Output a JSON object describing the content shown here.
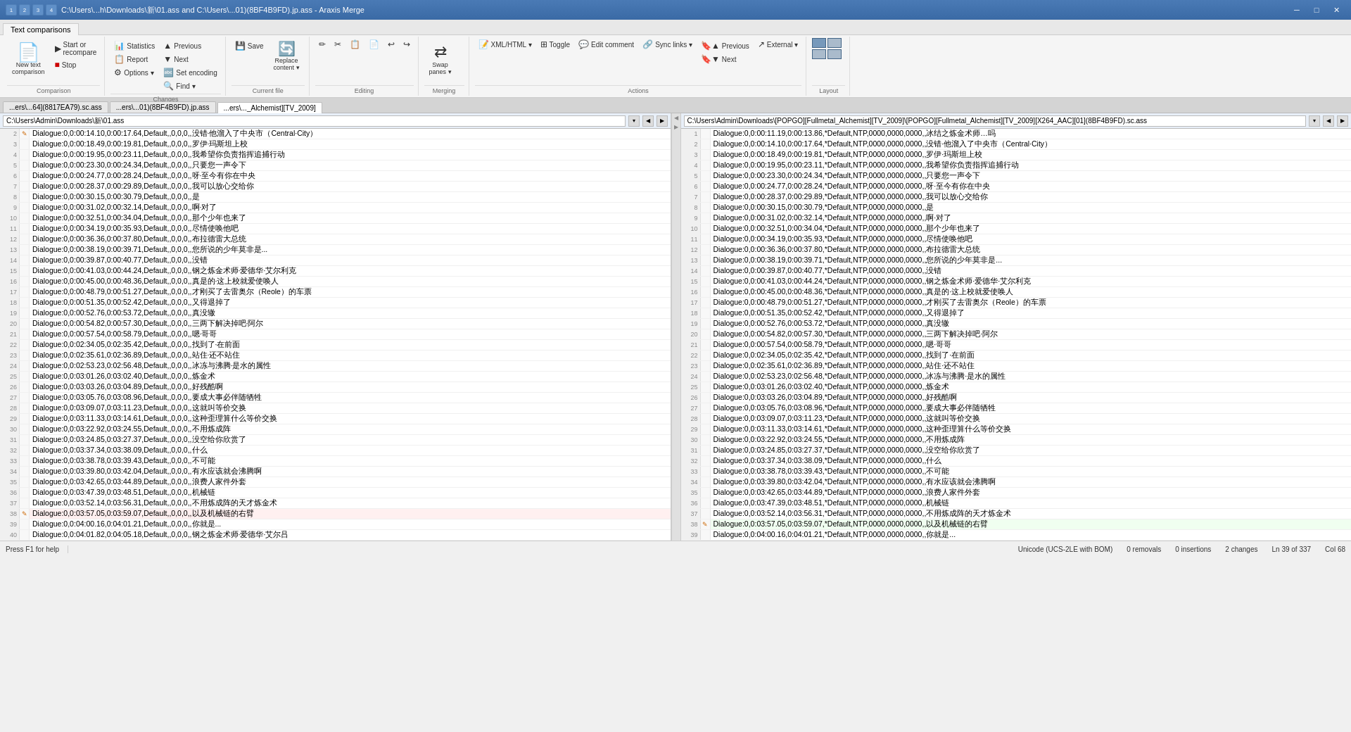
{
  "titleBar": {
    "title": "C:\\Users\\...h\\Downloads\\新\\01.ass and C:\\Users\\...01)(8BF4B9FD).jp.ass - Araxis Merge",
    "icons": [
      "1",
      "2",
      "3",
      "4"
    ],
    "appName": "Araxis Merge"
  },
  "ribbonTabs": [
    {
      "label": "Text comparisons",
      "active": true
    }
  ],
  "groups": {
    "comparison": {
      "label": "Comparison",
      "newText": "New text\ncomparison",
      "startRecompare": "Start or\nrecompare",
      "stop": "Stop"
    },
    "changes": {
      "label": "Changes",
      "statistics": "Statistics",
      "report": "Report",
      "previous": "Previous",
      "next": "Next",
      "setEncoding": "Set encoding",
      "find": "Find ▾",
      "options": "Options ▾"
    },
    "currentFile": {
      "label": "Current file",
      "save": "Save",
      "replaceContent": "Replace\ncontent ▾"
    },
    "editing": {
      "label": "Editing"
    },
    "merging": {
      "label": "Merging",
      "swapPanes": "Swap\npanes ▾"
    },
    "actions": {
      "label": "Actions",
      "xmlHtml": "XML/HTML ▾",
      "syncLinks": "Sync links ▾",
      "external": "External ▾",
      "toggle": "Toggle",
      "editComment": "Edit comment",
      "previousBookmark": "Previous",
      "nextBookmark": "Next"
    },
    "layout": {
      "label": "Layout"
    }
  },
  "fileTabs": [
    {
      "label": "...ers\\...64](8817EA79).sc.ass",
      "active": false
    },
    {
      "label": "...ers\\...01)(8BF4B9FD).jp.ass",
      "active": false
    },
    {
      "label": "...ers\\..._Alchemist][TV_2009]",
      "active": true
    }
  ],
  "leftPanel": {
    "path": "C:\\Users\\Admin\\Downloads\\新\\01.ass",
    "lines": [
      {
        "num": 2,
        "marker": "✎",
        "changed": false,
        "text": "Dialogue:0,0:00:14.10,0:00:17.64,Default,,0,0,0,,没错·他溜入了中央市（Central·City）"
      },
      {
        "num": 3,
        "marker": "",
        "changed": false,
        "text": "Dialogue:0,0:00:18.49,0:00:19.81,Default,,0,0,0,,罗伊·玛斯坦上校"
      },
      {
        "num": 4,
        "marker": "",
        "changed": false,
        "text": "Dialogue:0,0:00:19.95,0:00:23.11,Default,,0,0,0,,我希望你负责指挥追捕行动"
      },
      {
        "num": 5,
        "marker": "",
        "changed": false,
        "text": "Dialogue:0,0:00:23.30,0:00:24.34,Default,,0,0,0,,只要您一声令下"
      },
      {
        "num": 6,
        "marker": "",
        "changed": false,
        "text": "Dialogue:0,0:00:24.77,0:00:28.24,Default,,0,0,0,,呀·至今有你在中央"
      },
      {
        "num": 7,
        "marker": "",
        "changed": false,
        "text": "Dialogue:0,0:00:28.37,0:00:29.89,Default,,0,0,0,,我可以放心交给你"
      },
      {
        "num": 8,
        "marker": "",
        "changed": false,
        "text": "Dialogue:0,0:00:30.15,0:00:30.79,Default,,0,0,0,,是"
      },
      {
        "num": 9,
        "marker": "",
        "changed": false,
        "text": "Dialogue:0,0:00:31.02,0:00:32.14,Default,,0,0,0,,啊·对了"
      },
      {
        "num": 10,
        "marker": "",
        "changed": false,
        "text": "Dialogue:0,0:00:32.51,0:00:34.04,Default,,0,0,0,,那个少年也来了"
      },
      {
        "num": 11,
        "marker": "",
        "changed": false,
        "text": "Dialogue:0,0:00:34.19,0:00:35.93,Default,,0,0,0,,尽情使唤他吧"
      },
      {
        "num": 12,
        "marker": "",
        "changed": false,
        "text": "Dialogue:0,0:00:36.36,0:00:37.80,Default,,0,0,0,,布拉德雷大总统"
      },
      {
        "num": 13,
        "marker": "",
        "changed": false,
        "text": "Dialogue:0,0:00:38.19,0:00:39.71,Default,,0,0,0,,您所说的少年莫非是..."
      },
      {
        "num": 14,
        "marker": "",
        "changed": false,
        "text": "Dialogue:0,0:00:39.87,0:00:40.77,Default,,0,0,0,,没错"
      },
      {
        "num": 15,
        "marker": "",
        "changed": false,
        "text": "Dialogue:0,0:00:41.03,0:00:44.24,Default,,0,0,0,,钢之炼金术师·爱德华·艾尔利克"
      },
      {
        "num": 16,
        "marker": "",
        "changed": false,
        "text": "Dialogue:0,0:00:45.00,0:00:48.36,Default,,0,0,0,,真是的·这上校就爱使唤人"
      },
      {
        "num": 17,
        "marker": "",
        "changed": false,
        "text": "Dialogue:0,0:00:48.79,0:00:51.27,Default,,0,0,0,,才刚买了去雷奥尔（Reole）的车票"
      },
      {
        "num": 18,
        "marker": "",
        "changed": false,
        "text": "Dialogue:0,0:00:51.35,0:00:52.42,Default,,0,0,0,,又得退掉了"
      },
      {
        "num": 19,
        "marker": "",
        "changed": false,
        "text": "Dialogue:0,0:00:52.76,0:00:53.72,Default,,0,0,0,,真没辙"
      },
      {
        "num": 20,
        "marker": "",
        "changed": false,
        "text": "Dialogue:0,0:00:54.82,0:00:57.30,Default,,0,0,0,,三两下解决掉吧·阿尔"
      },
      {
        "num": 21,
        "marker": "",
        "changed": false,
        "text": "Dialogue:0,0:00:57.54,0:00:58.79,Default,,0,0,0,,嗯·哥哥"
      },
      {
        "num": 22,
        "marker": "",
        "changed": false,
        "text": "Dialogue:0,0:02:34.05,0:02:35.42,Default,,0,0,0,,找到了·在前面"
      },
      {
        "num": 23,
        "marker": "",
        "changed": false,
        "text": "Dialogue:0,0:02:35.61,0:02:36.89,Default,,0,0,0,,站住·还不站住"
      },
      {
        "num": 24,
        "marker": "",
        "changed": false,
        "text": "Dialogue:0,0:02:53.23,0:02:56.48,Default,,0,0,0,,冰冻与沸腾·是水的属性"
      },
      {
        "num": 25,
        "marker": "",
        "changed": false,
        "text": "Dialogue:0,0:03:01.26,0:03:02.40,Default,,0,0,0,,炼金术"
      },
      {
        "num": 26,
        "marker": "",
        "changed": false,
        "text": "Dialogue:0,0:03:03.26,0:03:04.89,Default,,0,0,0,,好残酷啊"
      },
      {
        "num": 27,
        "marker": "",
        "changed": false,
        "text": "Dialogue:0,0:03:05.76,0:03:08.96,Default,,0,0,0,,要成大事必伴随牺牲"
      },
      {
        "num": 28,
        "marker": "",
        "changed": false,
        "text": "Dialogue:0,0:03:09.07,0:03:11.23,Default,,0,0,0,,这就叫等价交换"
      },
      {
        "num": 29,
        "marker": "",
        "changed": false,
        "text": "Dialogue:0,0:03:11.33,0:03:14.61,Default,,0,0,0,,这种歪理算什么等价交换"
      },
      {
        "num": 30,
        "marker": "",
        "changed": false,
        "text": "Dialogue:0,0:03:22.92,0:03:24.55,Default,,0,0,0,,不用炼成阵"
      },
      {
        "num": 31,
        "marker": "",
        "changed": false,
        "text": "Dialogue:0,0:03:24.85,0:03:27.37,Default,,0,0,0,,没空给你欣赏了"
      },
      {
        "num": 32,
        "marker": "",
        "changed": false,
        "text": "Dialogue:0,0:03:37.34,0:03:38.09,Default,,0,0,0,,什么"
      },
      {
        "num": 33,
        "marker": "",
        "changed": false,
        "text": "Dialogue:0,0:03:38.78,0:03:39.43,Default,,0,0,0,,不可能"
      },
      {
        "num": 34,
        "marker": "",
        "changed": false,
        "text": "Dialogue:0,0:03:39.80,0:03:42.04,Default,,0,0,0,,有水应该就会沸腾啊"
      },
      {
        "num": 35,
        "marker": "",
        "changed": false,
        "text": "Dialogue:0,0:03:42.65,0:03:44.89,Default,,0,0,0,,浪费人家件外套"
      },
      {
        "num": 36,
        "marker": "",
        "changed": false,
        "text": "Dialogue:0,0:03:47.39,0:03:48.51,Default,,0,0,0,,机械链"
      },
      {
        "num": 37,
        "marker": "",
        "changed": false,
        "text": "Dialogue:0,0:03:52.14,0:03:56.31,Default,,0,0,0,,不用炼成阵的天才炼金术"
      },
      {
        "num": 38,
        "marker": "✎",
        "changed": true,
        "text": "Dialogue:0,0:03:57.05,0:03:59.07,Default,,0,0,0,,以及机械链的右臂"
      },
      {
        "num": 39,
        "marker": "",
        "changed": false,
        "text": "Dialogue:0,0:04:00.16,0:04:01.21,Default,,0,0,0,,你就是..."
      },
      {
        "num": 40,
        "marker": "",
        "changed": false,
        "text": "Dialogue:0,0:04:01.82,0:04:05.18,Default,,0,0,0,,钢之炼金术师·爱德华·艾尔吕"
      }
    ]
  },
  "rightPanel": {
    "path": "C:\\Users\\Admin\\Downloads\\[POPGO][Fullmetal_Alchemist][TV_2009]\\[POPGO][Fullmetal_Alchemist][TV_2009][X264_AAC][01](8BF4B9FD).sc.ass",
    "lines": [
      {
        "num": 1,
        "marker": "",
        "changed": false,
        "text": "Dialogue:0,0:00:11.19,0:00:13.86,*Default,NTP,0000,0000,0000,,冰结之炼金术师…吗"
      },
      {
        "num": 2,
        "marker": "",
        "changed": false,
        "text": "Dialogue:0,0:00:14.10,0:00:17.64,*Default,NTP,0000,0000,0000,,没错·他溜入了中央市（Central·City）"
      },
      {
        "num": 3,
        "marker": "",
        "changed": false,
        "text": "Dialogue:0,0:00:18.49,0:00:19.81,*Default,NTP,0000,0000,0000,,罗伊·玛斯坦上校"
      },
      {
        "num": 4,
        "marker": "",
        "changed": false,
        "text": "Dialogue:0,0:00:19.95,0:00:23.11,*Default,NTP,0000,0000,0000,,我希望你负责指挥追捕行动"
      },
      {
        "num": 5,
        "marker": "",
        "changed": false,
        "text": "Dialogue:0,0:00:23.30,0:00:24.34,*Default,NTP,0000,0000,0000,,只要您一声令下"
      },
      {
        "num": 6,
        "marker": "",
        "changed": false,
        "text": "Dialogue:0,0:00:24.77,0:00:28.24,*Default,NTP,0000,0000,0000,,呀·至今有你在中央"
      },
      {
        "num": 7,
        "marker": "",
        "changed": false,
        "text": "Dialogue:0,0:00:28.37,0:00:29.89,*Default,NTP,0000,0000,0000,,我可以放心交给你"
      },
      {
        "num": 8,
        "marker": "",
        "changed": false,
        "text": "Dialogue:0,0:00:30.15,0:00:30.79,*Default,NTP,0000,0000,0000,,是"
      },
      {
        "num": 9,
        "marker": "",
        "changed": false,
        "text": "Dialogue:0,0:00:31.02,0:00:32.14,*Default,NTP,0000,0000,0000,,啊·对了"
      },
      {
        "num": 10,
        "marker": "",
        "changed": false,
        "text": "Dialogue:0,0:00:32.51,0:00:34.04,*Default,NTP,0000,0000,0000,,那个少年也来了"
      },
      {
        "num": 11,
        "marker": "",
        "changed": false,
        "text": "Dialogue:0,0:00:34.19,0:00:35.93,*Default,NTP,0000,0000,0000,,尽情使唤他吧"
      },
      {
        "num": 12,
        "marker": "",
        "changed": false,
        "text": "Dialogue:0,0:00:36.36,0:00:37.80,*Default,NTP,0000,0000,0000,,布拉德雷大总统"
      },
      {
        "num": 13,
        "marker": "",
        "changed": false,
        "text": "Dialogue:0,0:00:38.19,0:00:39.71,*Default,NTP,0000,0000,0000,,您所说的少年莫非是..."
      },
      {
        "num": 14,
        "marker": "",
        "changed": false,
        "text": "Dialogue:0,0:00:39.87,0:00:40.77,*Default,NTP,0000,0000,0000,,没错"
      },
      {
        "num": 15,
        "marker": "",
        "changed": false,
        "text": "Dialogue:0,0:00:41.03,0:00:44.24,*Default,NTP,0000,0000,0000,,钢之炼金术师·爱德华·艾尔利克"
      },
      {
        "num": 16,
        "marker": "",
        "changed": false,
        "text": "Dialogue:0,0:00:45.00,0:00:48.36,*Default,NTP,0000,0000,0000,,真是的·这上校就爱使唤人"
      },
      {
        "num": 17,
        "marker": "",
        "changed": false,
        "text": "Dialogue:0,0:00:48.79,0:00:51.27,*Default,NTP,0000,0000,0000,,才刚买了去雷奥尔（Reole）的车票"
      },
      {
        "num": 18,
        "marker": "",
        "changed": false,
        "text": "Dialogue:0,0:00:51.35,0:00:52.42,*Default,NTP,0000,0000,0000,,又得退掉了"
      },
      {
        "num": 19,
        "marker": "",
        "changed": false,
        "text": "Dialogue:0,0:00:52.76,0:00:53.72,*Default,NTP,0000,0000,0000,,真没辙"
      },
      {
        "num": 20,
        "marker": "",
        "changed": false,
        "text": "Dialogue:0,0:00:54.82,0:00:57.30,*Default,NTP,0000,0000,0000,,三两下解决掉吧·阿尔"
      },
      {
        "num": 21,
        "marker": "",
        "changed": false,
        "text": "Dialogue:0,0:00:57.54,0:00:58.79,*Default,NTP,0000,0000,0000,,嗯·哥哥"
      },
      {
        "num": 22,
        "marker": "",
        "changed": false,
        "text": "Dialogue:0,0:02:34.05,0:02:35.42,*Default,NTP,0000,0000,0000,,找到了·在前面"
      },
      {
        "num": 23,
        "marker": "",
        "changed": false,
        "text": "Dialogue:0,0:02:35.61,0:02:36.89,*Default,NTP,0000,0000,0000,,站住·还不站住"
      },
      {
        "num": 24,
        "marker": "",
        "changed": false,
        "text": "Dialogue:0,0:02:53.23,0:02:56.48,*Default,NTP,0000,0000,0000,,冰冻与沸腾·是水的属性"
      },
      {
        "num": 25,
        "marker": "",
        "changed": false,
        "text": "Dialogue:0,0:03:01.26,0:03:02.40,*Default,NTP,0000,0000,0000,,炼金术"
      },
      {
        "num": 26,
        "marker": "",
        "changed": false,
        "text": "Dialogue:0,0:03:03.26,0:03:04.89,*Default,NTP,0000,0000,0000,,好残酷啊"
      },
      {
        "num": 27,
        "marker": "",
        "changed": false,
        "text": "Dialogue:0,0:03:05.76,0:03:08.96,*Default,NTP,0000,0000,0000,,要成大事必伴随牺牲"
      },
      {
        "num": 28,
        "marker": "",
        "changed": false,
        "text": "Dialogue:0,0:03:09.07,0:03:11.23,*Default,NTP,0000,0000,0000,,这就叫等价交换"
      },
      {
        "num": 29,
        "marker": "",
        "changed": false,
        "text": "Dialogue:0,0:03:11.33,0:03:14.61,*Default,NTP,0000,0000,0000,,这种歪理算什么等价交换"
      },
      {
        "num": 30,
        "marker": "",
        "changed": false,
        "text": "Dialogue:0,0:03:22.92,0:03:24.55,*Default,NTP,0000,0000,0000,,不用炼成阵"
      },
      {
        "num": 31,
        "marker": "",
        "changed": false,
        "text": "Dialogue:0,0:03:24.85,0:03:27.37,*Default,NTP,0000,0000,0000,,没空给你欣赏了"
      },
      {
        "num": 32,
        "marker": "",
        "changed": false,
        "text": "Dialogue:0,0:03:37.34,0:03:38.09,*Default,NTP,0000,0000,0000,,什么"
      },
      {
        "num": 33,
        "marker": "",
        "changed": false,
        "text": "Dialogue:0,0:03:38.78,0:03:39.43,*Default,NTP,0000,0000,0000,,不可能"
      },
      {
        "num": 34,
        "marker": "",
        "changed": false,
        "text": "Dialogue:0,0:03:39.80,0:03:42.04,*Default,NTP,0000,0000,0000,,有水应该就会沸腾啊"
      },
      {
        "num": 35,
        "marker": "",
        "changed": false,
        "text": "Dialogue:0,0:03:42.65,0:03:44.89,*Default,NTP,0000,0000,0000,,浪费人家件外套"
      },
      {
        "num": 36,
        "marker": "",
        "changed": false,
        "text": "Dialogue:0,0:03:47.39,0:03:48.51,*Default,NTP,0000,0000,0000,,机械链"
      },
      {
        "num": 37,
        "marker": "",
        "changed": false,
        "text": "Dialogue:0,0:03:52.14,0:03:56.31,*Default,NTP,0000,0000,0000,,不用炼成阵的天才炼金术"
      },
      {
        "num": 38,
        "marker": "✎",
        "changed": true,
        "text": "Dialogue:0,0:03:57.05,0:03:59.07,*Default,NTP,0000,0000,0000,,以及机械链的右臂"
      },
      {
        "num": 39,
        "marker": "",
        "changed": false,
        "text": "Dialogue:0,0:04:00.16,0:04:01.21,*Default,NTP,0000,0000,0000,,你就是..."
      }
    ]
  },
  "statusBar": {
    "help": "Press F1 for help",
    "encoding": "Unicode (UCS-2LE with BOM)",
    "removals": "0 removals",
    "insertions": "0 insertions",
    "changes": "2 changes",
    "position": "Ln 39 of 337",
    "col": "Col 68"
  }
}
